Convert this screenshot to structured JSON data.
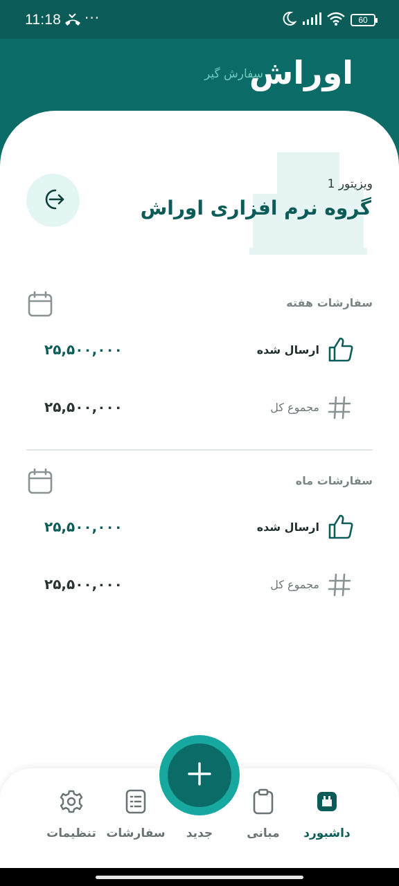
{
  "status_bar": {
    "time": "11:18",
    "dots": "···",
    "battery": "60",
    "icons": [
      "missed-call-icon",
      "moon-icon",
      "signal-icon",
      "wifi-icon",
      "battery-icon"
    ]
  },
  "header": {
    "brand": "اوراش",
    "subtitle": "سفارش گیر"
  },
  "profile": {
    "role": "ویزیتور 1",
    "company": "گروه نرم افزاری اوراش"
  },
  "weekly": {
    "title": "سفارشات هفته",
    "sent_label": "ارسال شده",
    "sent_value": "۲۵,۵۰۰,۰۰۰",
    "total_label": "مجموع کل",
    "total_value": "۲۵,۵۰۰,۰۰۰"
  },
  "monthly": {
    "title": "سفارشات ماه",
    "sent_label": "ارسال شده",
    "sent_value": "۲۵,۵۰۰,۰۰۰",
    "total_label": "مجموع کل",
    "total_value": "۲۵,۵۰۰,۰۰۰"
  },
  "nav": {
    "dashboard": "داشبورد",
    "basics": "مبانی",
    "new": "جدید",
    "orders": "سفارشات",
    "settings": "تنظیمات",
    "active": "dashboard"
  },
  "colors": {
    "primary": "#0b6b66",
    "primary_dark": "#0b5c58",
    "accent": "#17a99f",
    "soft": "#e4f6f4"
  }
}
